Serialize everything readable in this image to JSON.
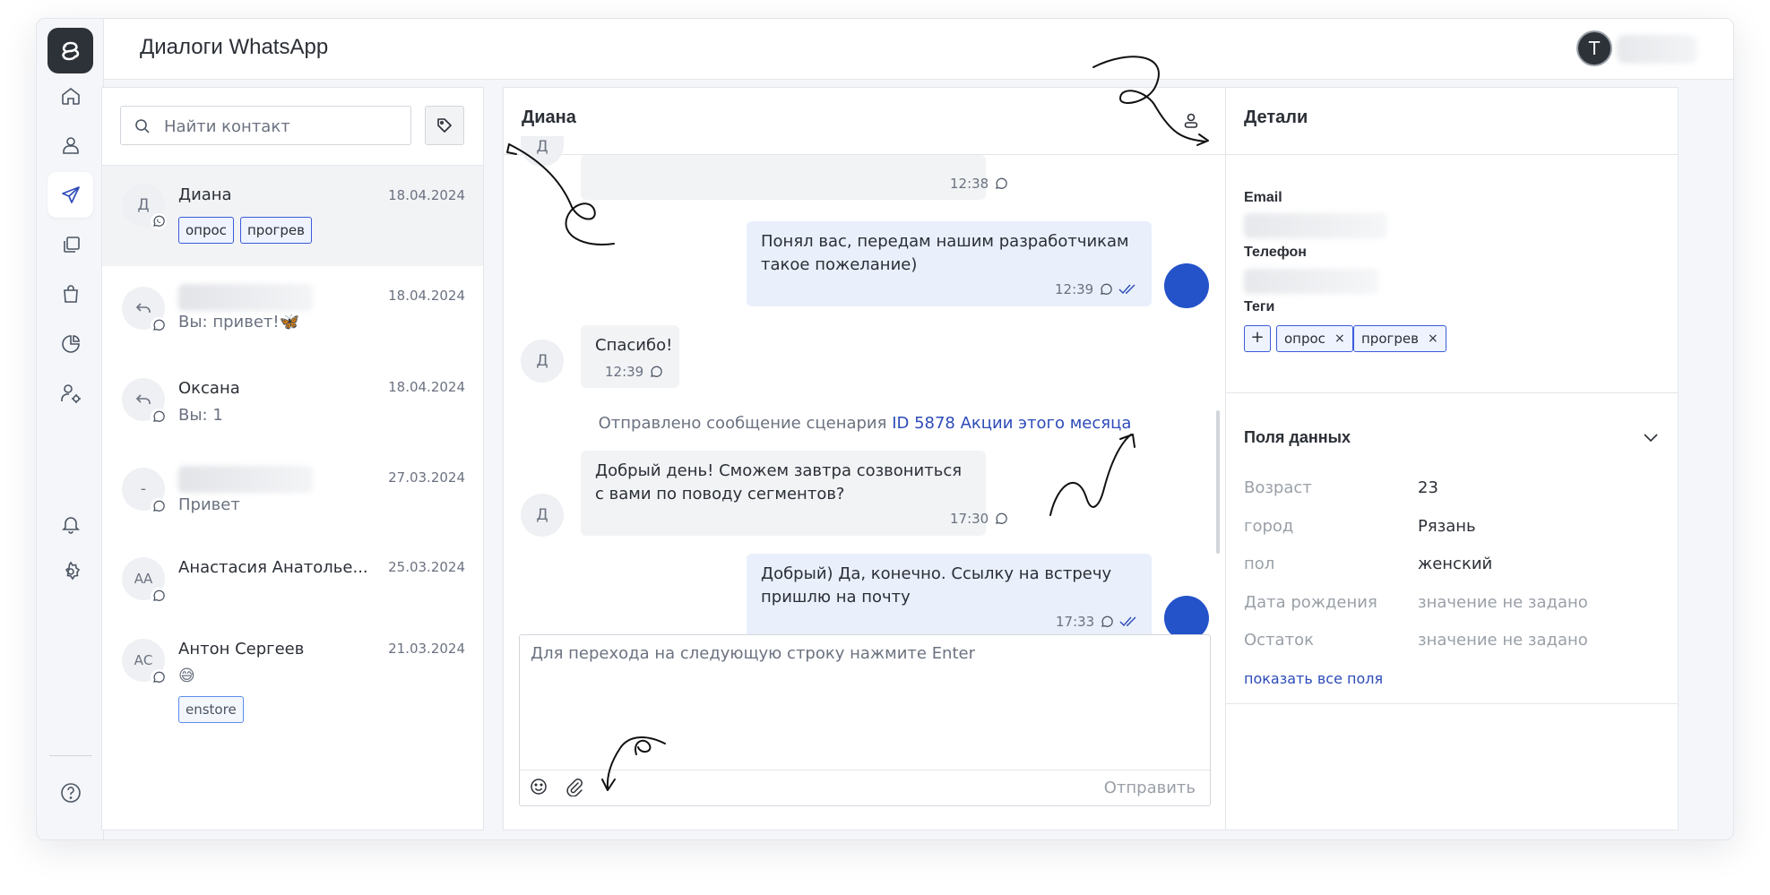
{
  "app": {
    "page_title": "Диалоги WhatsApp",
    "user_initial": "Т"
  },
  "rail": {
    "items": [
      "logo-icon",
      "home-icon",
      "user-icon",
      "send-icon",
      "copy-icon",
      "bag-icon",
      "pie-chart-icon",
      "user-settings-icon",
      "bell-icon",
      "gear-icon",
      "help-icon"
    ],
    "active": "send-icon"
  },
  "contacts": {
    "search_placeholder": "Найти контакт",
    "list": [
      {
        "initials": "Д",
        "name": "Диана",
        "date": "18.04.2024",
        "preview": "",
        "tags": [
          "опрос",
          "прогрев"
        ]
      },
      {
        "initials": "↩",
        "name": "",
        "date": "18.04.2024",
        "preview": "Вы: привет!🦋",
        "tags": []
      },
      {
        "initials": "↩",
        "name": "Оксана",
        "date": "18.04.2024",
        "preview": "Вы: 1",
        "tags": []
      },
      {
        "initials": "-",
        "name": "",
        "date": "27.03.2024",
        "preview": "Привет",
        "tags": []
      },
      {
        "initials": "АА",
        "name": "Анастасия Анатолье...",
        "date": "25.03.2024",
        "preview": "",
        "tags": []
      },
      {
        "initials": "АС",
        "name": "Антон Сергеев",
        "date": "21.03.2024",
        "preview": "😅",
        "tags": [
          "enstore"
        ]
      }
    ]
  },
  "chat": {
    "contact_name": "Диана",
    "avatar_initial": "Д",
    "messages": [
      {
        "dir": "in",
        "text": "",
        "time": "12:38"
      },
      {
        "dir": "out",
        "text": "Понял вас, передам нашим разработчикам такое пожелание)",
        "time": "12:39"
      },
      {
        "dir": "in",
        "text": "Спасибо!",
        "time": "12:39"
      },
      {
        "dir": "in",
        "text": "Добрый день! Сможем завтра созвониться с вами по поводу сегментов?",
        "time": "17:30"
      },
      {
        "dir": "out",
        "text": "Добрый) Да, конечно. Ссылку на встречу пришлю на почту",
        "time": "17:33"
      }
    ],
    "system_message": {
      "prefix": "Отправлено сообщение сценария",
      "link": "ID 5878 Акции этого месяца"
    },
    "composer_placeholder": "Для перехода на следующую строку нажмите Enter",
    "send_label": "Отправить"
  },
  "details": {
    "title": "Детали",
    "email_label": "Email",
    "phone_label": "Телефон",
    "tags_label": "Теги",
    "tag_add": "+",
    "tags": [
      "опрос",
      "прогрев"
    ],
    "tag_remove": "×",
    "fields_title": "Поля данных",
    "fields": [
      {
        "key": "Возраст",
        "value": "23",
        "empty": false
      },
      {
        "key": "город",
        "value": "Рязань",
        "empty": false
      },
      {
        "key": "пол",
        "value": "женский",
        "empty": false
      },
      {
        "key": "Дата рождения",
        "value": "значение не задано",
        "empty": true
      },
      {
        "key": "Остаток",
        "value": "значение не задано",
        "empty": true
      }
    ],
    "show_all": "показать все поля"
  },
  "colors": {
    "accent": "#2c4bb8",
    "out_avatar": "#2452c9",
    "bubble_out": "#e9effb",
    "bubble_in": "#f1f3f5"
  }
}
